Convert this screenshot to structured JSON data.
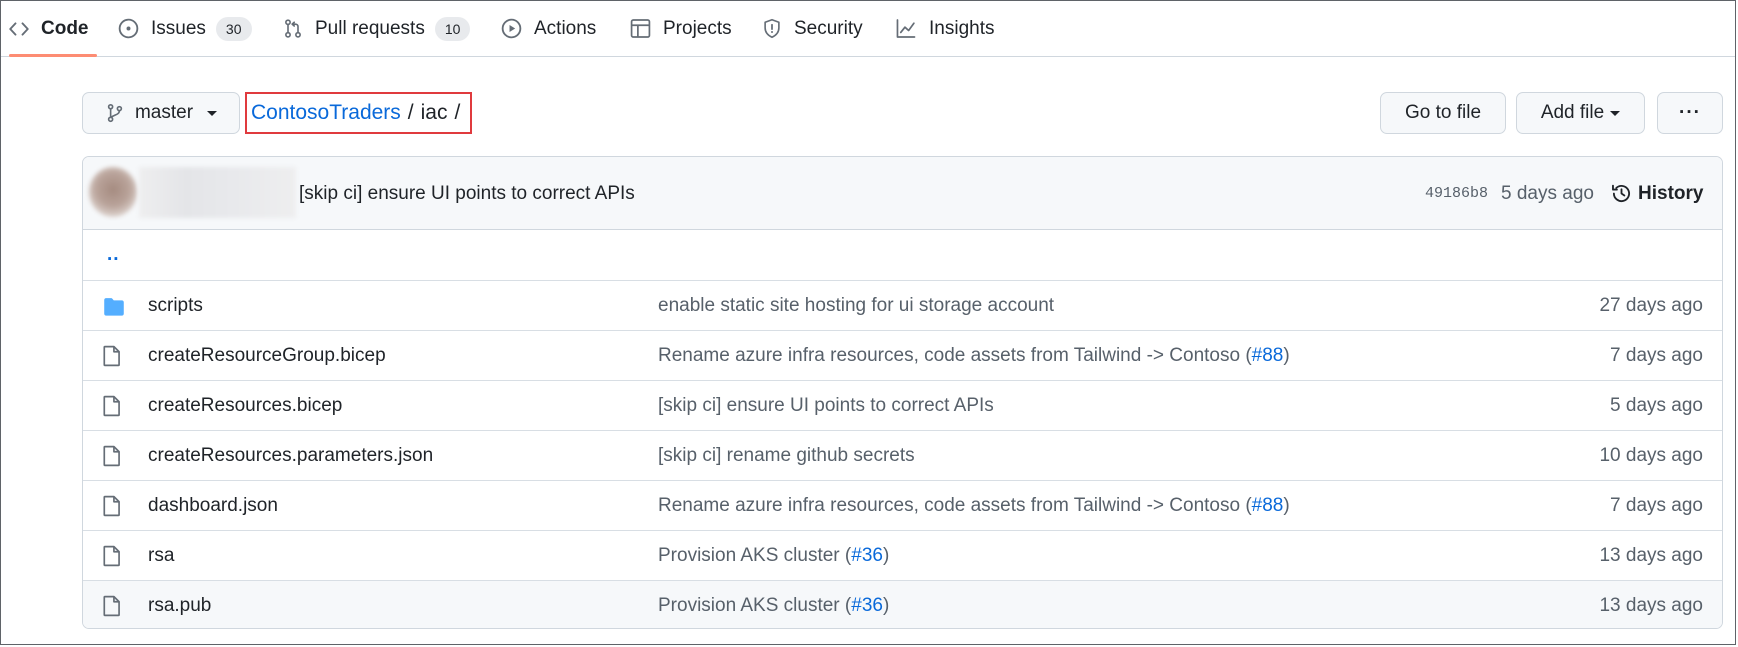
{
  "nav": {
    "tabs": [
      {
        "label": "Code",
        "icon": "code-icon"
      },
      {
        "label": "Issues",
        "count": "30",
        "icon": "issue-opened-icon"
      },
      {
        "label": "Pull requests",
        "count": "10",
        "icon": "git-pull-request-icon"
      },
      {
        "label": "Actions",
        "icon": "play-icon"
      },
      {
        "label": "Projects",
        "icon": "table-icon"
      },
      {
        "label": "Security",
        "icon": "shield-icon"
      },
      {
        "label": "Insights",
        "icon": "graph-icon"
      }
    ],
    "active_tab": "Code",
    "active_color": "#fd8c73"
  },
  "toolbar": {
    "branch_label": "master",
    "go_to_file_label": "Go to file",
    "add_file_label": "Add file",
    "more_label": "···"
  },
  "breadcrumb": {
    "repo": "ContosoTraders",
    "separator": "/",
    "dir": "iac",
    "trailing": "/",
    "highlight_color": "#e03a3e"
  },
  "latest_commit": {
    "message": "[skip ci] ensure UI points to correct APIs",
    "sha": "49186b8",
    "time": "5 days ago",
    "history_label": "History"
  },
  "parent_dir": "..",
  "files": [
    {
      "name": "scripts",
      "type": "folder",
      "message": "enable static site hosting for ui storage account",
      "pr": "",
      "pr_suffix": "",
      "time": "27 days ago"
    },
    {
      "name": "createResourceGroup.bicep",
      "type": "file",
      "message": "Rename azure infra resources, code assets from Tailwind -> Contoso (",
      "pr": "#88",
      "pr_suffix": ")",
      "time": "7 days ago"
    },
    {
      "name": "createResources.bicep",
      "type": "file",
      "message": "[skip ci] ensure UI points to correct APIs",
      "pr": "",
      "pr_suffix": "",
      "time": "5 days ago"
    },
    {
      "name": "createResources.parameters.json",
      "type": "file",
      "message": "[skip ci] rename github secrets",
      "pr": "",
      "pr_suffix": "",
      "time": "10 days ago"
    },
    {
      "name": "dashboard.json",
      "type": "file",
      "message": "Rename azure infra resources, code assets from Tailwind -> Contoso (",
      "pr": "#88",
      "pr_suffix": ")",
      "time": "7 days ago"
    },
    {
      "name": "rsa",
      "type": "file",
      "message": "Provision AKS cluster (",
      "pr": "#36",
      "pr_suffix": ")",
      "time": "13 days ago"
    },
    {
      "name": "rsa.pub",
      "type": "file",
      "message": "Provision AKS cluster (",
      "pr": "#36",
      "pr_suffix": ")",
      "time": "13 days ago"
    }
  ],
  "colors": {
    "link": "#0969da",
    "folder": "#54aeff",
    "muted": "#57606a"
  }
}
